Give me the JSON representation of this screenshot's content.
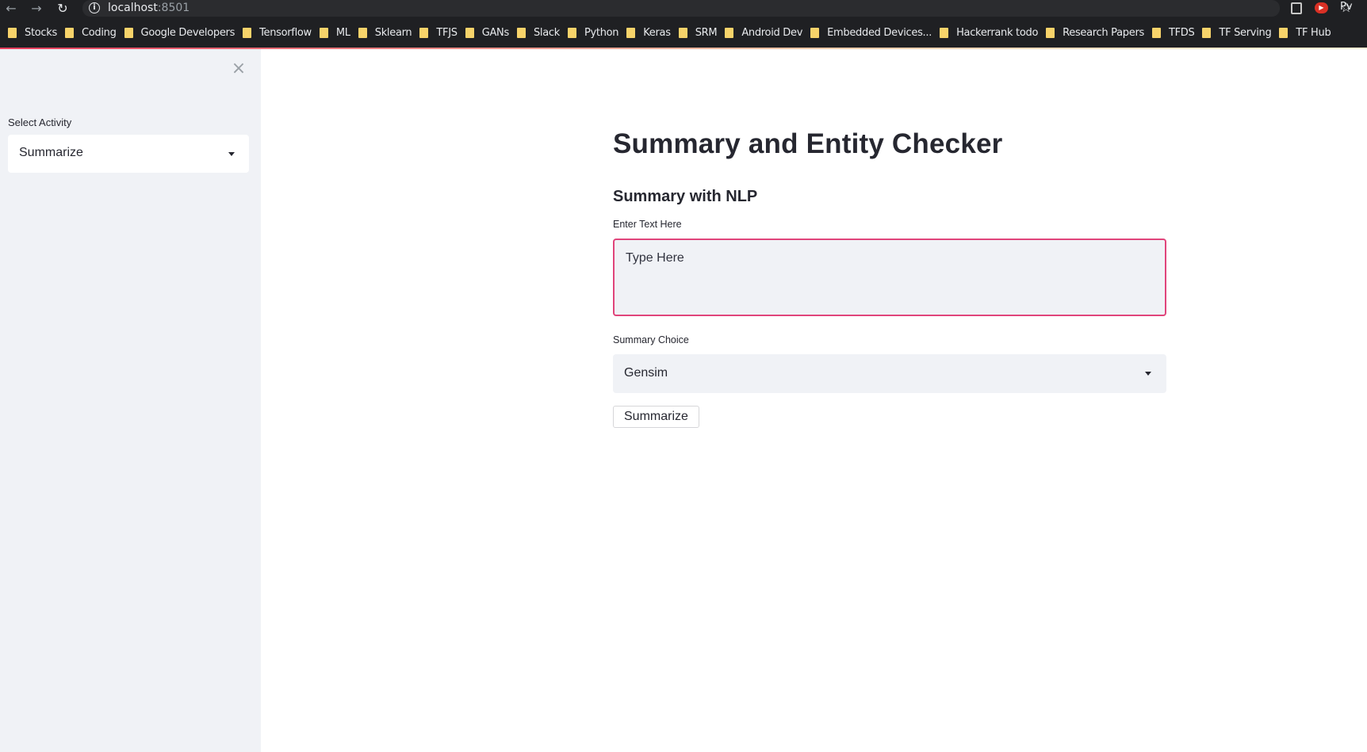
{
  "browser": {
    "url_host": "localhost",
    "url_port": ":8501",
    "profile_label": "Pv",
    "icons": [
      "back-arrow-icon",
      "forward-arrow-icon",
      "reload-icon",
      "info-icon",
      "star-icon",
      "extension-icon",
      "youtube-extension-icon"
    ],
    "bookmarks": [
      "Stocks",
      "Coding",
      "Google Developers",
      "Tensorflow",
      "ML",
      "Sklearn",
      "TFJS",
      "GANs",
      "Slack",
      "Python",
      "Keras",
      "SRM",
      "Android Dev",
      "Embedded Devices...",
      "Hackerrank todo",
      "Research Papers",
      "TFDS",
      "TF Serving",
      "TF Hub"
    ]
  },
  "sidebar": {
    "select_label": "Select Activity",
    "select_value": "Summarize"
  },
  "main": {
    "title": "Summary and Entity Checker",
    "subheader": "Summary with NLP",
    "text_label": "Enter Text Here",
    "text_placeholder": "Type Here",
    "choice_label": "Summary Choice",
    "choice_value": "Gensim",
    "button_label": "Summarize"
  },
  "colors": {
    "chrome_bg": "#1f2023",
    "sidebar_bg": "#f0f2f6",
    "input_bg": "#f0f2f6",
    "focus_border": "#e0457b",
    "text": "#262730",
    "bookmark_folder": "#f7d36a"
  }
}
